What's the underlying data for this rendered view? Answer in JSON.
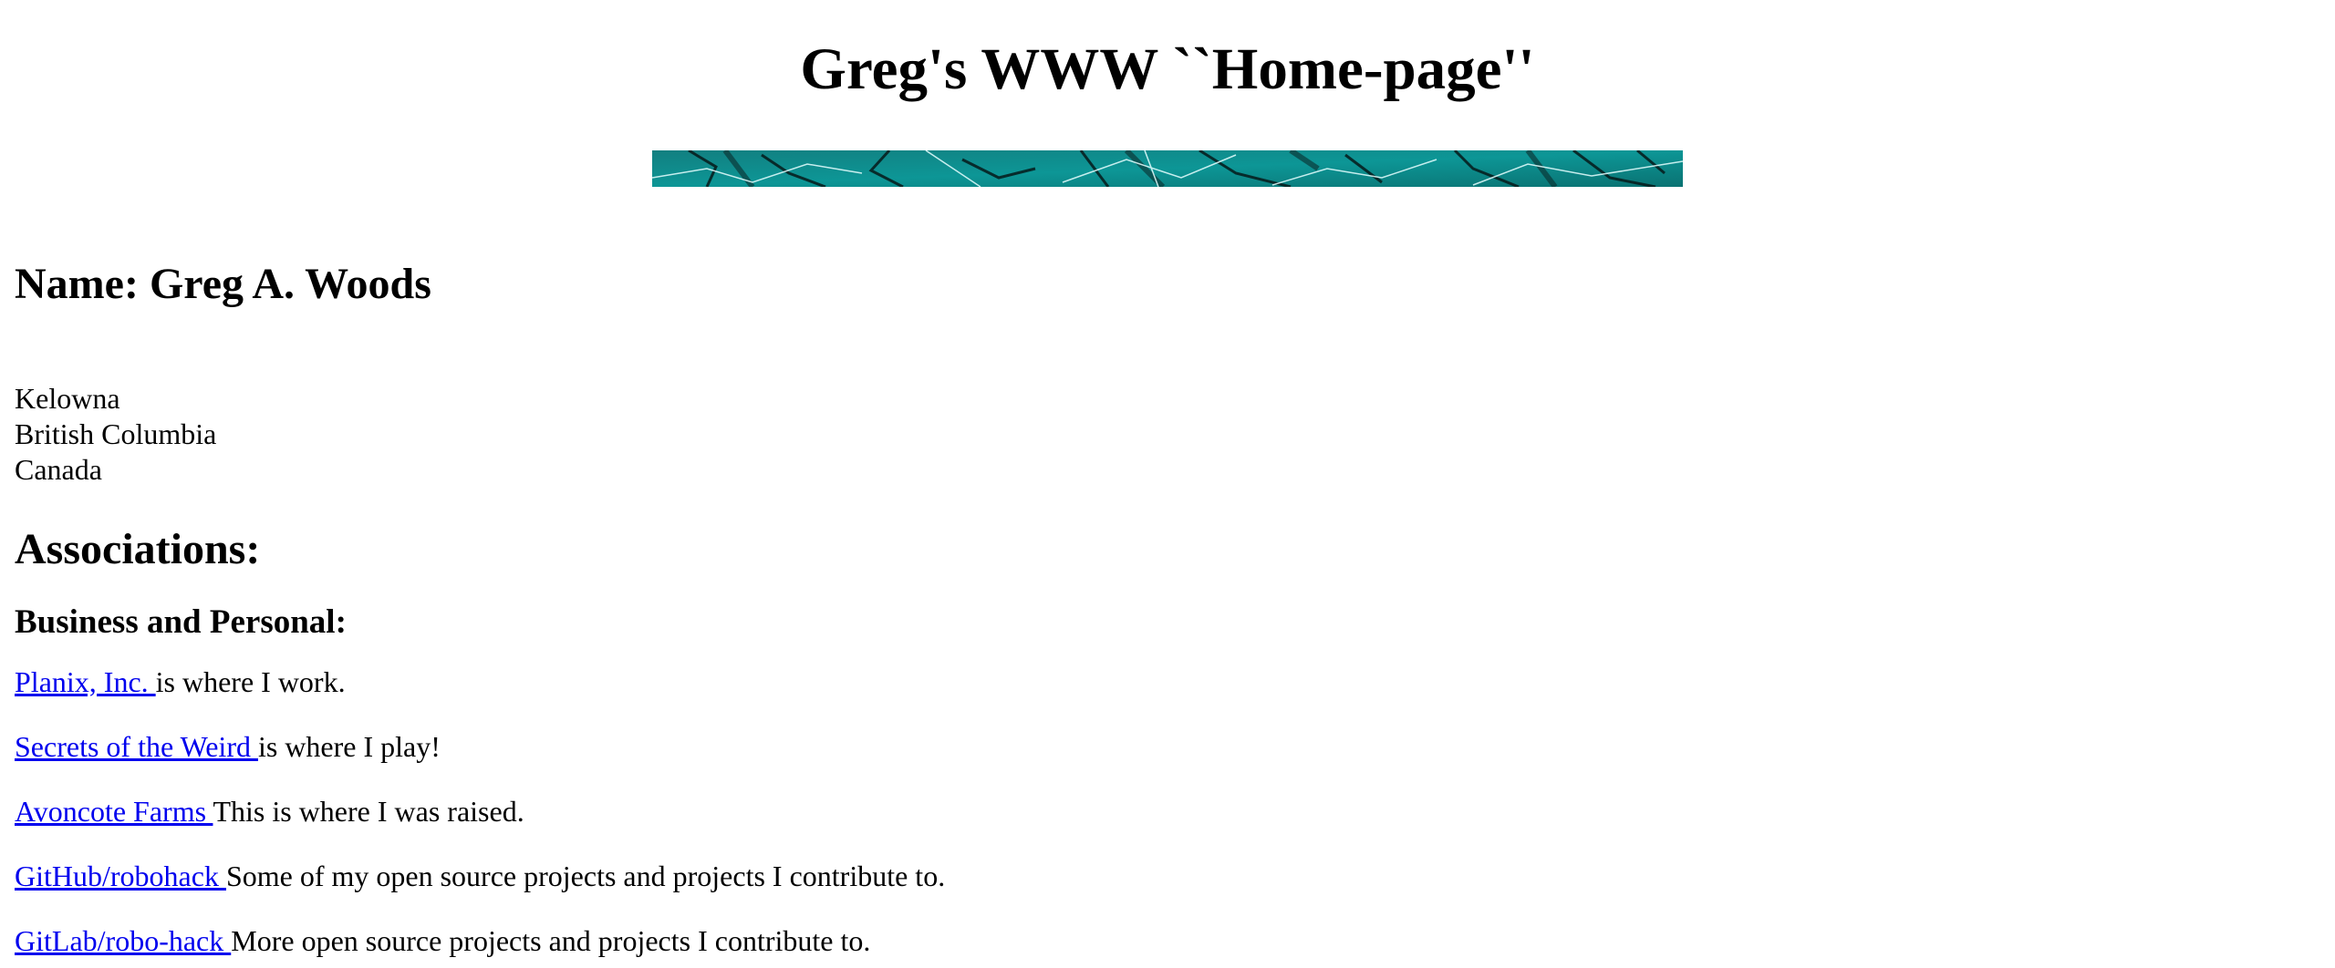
{
  "page": {
    "title": "Greg's WWW ``Home-page''"
  },
  "banner": {
    "description": "teal-marble-banner"
  },
  "profile": {
    "name_heading": "Name: Greg A. Woods",
    "address": {
      "city": "Kelowna",
      "province": "British Columbia",
      "country": "Canada"
    }
  },
  "associations": {
    "heading": "Associations:",
    "subheading": "Business and Personal:",
    "items": [
      {
        "link_text": "Planix, Inc. ",
        "description": "is where I work."
      },
      {
        "link_text": "Secrets of the Weird ",
        "description": "is where I play!"
      },
      {
        "link_text": "Avoncote Farms ",
        "description": "This is where I was raised."
      },
      {
        "link_text": "GitHub/robohack ",
        "description": "Some of my open source projects and projects I contribute to."
      },
      {
        "link_text": "GitLab/robo-hack ",
        "description": "More open source projects and projects I contribute to."
      }
    ]
  },
  "colors": {
    "link": "#0000ee",
    "text": "#000000",
    "background": "#ffffff",
    "banner_base": "#0f8a8a"
  }
}
